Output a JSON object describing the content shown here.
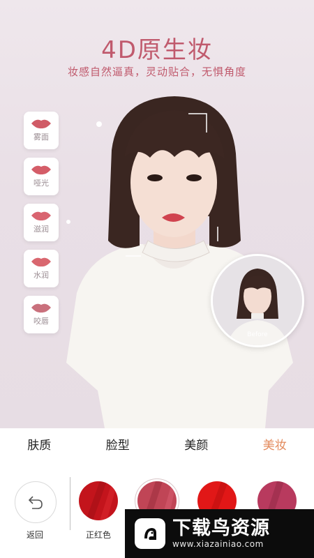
{
  "hero": {
    "title": "4D原生妆",
    "subtitle": "妆感自然逼真，灵动贴合，无惧角度",
    "before_label": "Before"
  },
  "lip_styles": [
    {
      "label": "雾面",
      "color": "#d05b66"
    },
    {
      "label": "哑光",
      "color": "#d45d68"
    },
    {
      "label": "滋润",
      "color": "#d96470"
    },
    {
      "label": "水润",
      "color": "#d9676f"
    },
    {
      "label": "咬唇",
      "color": "#c9707c"
    }
  ],
  "tabs": [
    {
      "label": "肤质",
      "active": false
    },
    {
      "label": "脸型",
      "active": false
    },
    {
      "label": "美颜",
      "active": false
    },
    {
      "label": "美妆",
      "active": true
    }
  ],
  "bottom": {
    "undo_label": "返回",
    "swatches": [
      {
        "label": "正红色",
        "color": "#c3141c",
        "selected": false
      },
      {
        "label": "",
        "color": "#c04556",
        "selected": true
      },
      {
        "label": "",
        "color": "#e11717",
        "selected": false
      },
      {
        "label": "",
        "color": "#b83a5e",
        "selected": false
      }
    ]
  },
  "watermark": {
    "text": "下载鸟资源",
    "url": "www.xiazainiao.com"
  },
  "colors": {
    "accent": "#c05a6d",
    "tab_active": "#e38a5c"
  }
}
